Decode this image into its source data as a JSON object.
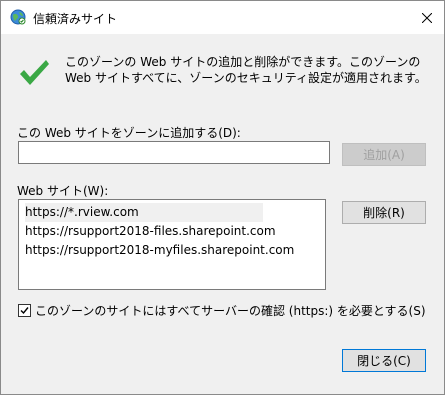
{
  "window": {
    "title": "信頼済みサイト",
    "icon": "globe-icon",
    "close_icon": "close-icon"
  },
  "info": {
    "icon": "checkmark-icon",
    "text": "このゾーンの Web サイトの追加と削除ができます。このゾーンの Web サイトすべてに、ゾーンのセキュリティ設定が適用されます。"
  },
  "add": {
    "label": "この Web サイトをゾーンに追加する(D):",
    "input_value": "",
    "button_label": "追加(A)"
  },
  "sites": {
    "label": "Web サイト(W):",
    "items": [
      "https://*.rview.com",
      "https://rsupport2018-files.sharepoint.com",
      "https://rsupport2018-myfiles.sharepoint.com"
    ],
    "remove_label": "削除(R)"
  },
  "https_check": {
    "label": "このゾーンのサイトにはすべてサーバーの確認 (https:) を必要とする(S)",
    "checked": true
  },
  "footer": {
    "close_label": "閉じる(C)"
  },
  "colors": {
    "check_green": "#3aa845",
    "focus_border": "#0078d7"
  }
}
